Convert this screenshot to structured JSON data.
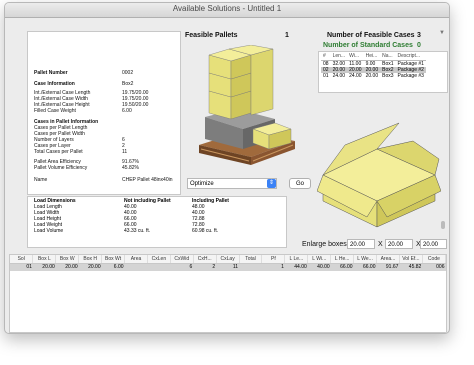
{
  "window": {
    "title": "Available Solutions - Untitled 1"
  },
  "info": {
    "rows": [
      {
        "label": "Pallet Number",
        "value": "0002",
        "bold": true
      },
      {
        "label": "Case Information",
        "value": "Box2",
        "bold": true
      },
      {
        "label": "Int./External Case Length",
        "value": "19.75/20.00",
        "bold": false
      },
      {
        "label": "Int./External Case Width",
        "value": "19.75/20.00",
        "bold": false
      },
      {
        "label": "Int./External Case Height",
        "value": "19.50/20.00",
        "bold": false
      },
      {
        "label": "Filled Case Weight",
        "value": "6.00",
        "bold": false
      },
      {
        "label": "Cases in Pallet Information",
        "value": "",
        "bold": true
      },
      {
        "label": "Cases per Pallet Length",
        "value": "",
        "bold": false
      },
      {
        "label": "Cases per Pallet Width",
        "value": "",
        "bold": false
      },
      {
        "label": "Number of Layers",
        "value": "6",
        "bold": false
      },
      {
        "label": "Cases per Layer",
        "value": "2",
        "bold": false
      },
      {
        "label": "Total Cases per Pallet",
        "value": "11",
        "bold": false
      },
      {
        "label": "Pallet Area Efficiency",
        "value": "91.67%",
        "bold": false
      },
      {
        "label": "Pallet Volume Efficiency",
        "value": "45.82%",
        "bold": false
      },
      {
        "label": "Name",
        "value": "CHEP Pallet 48inx40in",
        "bold": false
      }
    ]
  },
  "load": {
    "headers": [
      "Load Dimensions",
      "Not including Pallet",
      "Including Pallet"
    ],
    "rows": [
      [
        "Load Length",
        "40.00",
        "48.00"
      ],
      [
        "Load Width",
        "40.00",
        "40.00"
      ],
      [
        "Load Height",
        "66.00",
        "72.88"
      ],
      [
        "Load Weight",
        "66.00",
        "72.80"
      ],
      [
        "Load Volume",
        "43.33 cu. ft.",
        "60.98 cu. ft."
      ]
    ]
  },
  "feasible": {
    "label": "Feasible Pallets",
    "count": "1",
    "optimize_value": "Optimize",
    "go_label": "Go"
  },
  "cases": {
    "feasible_label": "Number of Feasible Cases",
    "feasible_count": "3",
    "standard_label": "Number of Standard Cases",
    "standard_count": "0",
    "headers": [
      "#",
      "Len...",
      "Wi...",
      "Hei...",
      "Na...",
      "Descript..."
    ],
    "rows": [
      [
        "08",
        "32.00",
        "11.00",
        "9.00",
        "Box1",
        "Package #1"
      ],
      [
        "02",
        "20.00",
        "20.00",
        "20.00",
        "Box2",
        "Package #2"
      ],
      [
        "01",
        "24.00",
        "24.00",
        "20.00",
        "Box3",
        "Package #3"
      ]
    ]
  },
  "enlarge": {
    "label": "Enlarge boxes",
    "x1": "20.00",
    "x2": "20.00",
    "x3": "20.00",
    "sep": "X"
  },
  "grid": {
    "headers": [
      "Sol",
      "Box L",
      "Box W",
      "Box H",
      "Box Wt",
      "Area",
      "CxLen",
      "CxWid",
      "CxH...",
      "CxLay",
      "Total",
      "Pf",
      "L Le...",
      "L Wi...",
      "L He...",
      "L We...",
      "Area...",
      "Vol Ef...",
      "Code"
    ],
    "rows": [
      [
        "01",
        "20.00",
        "20.00",
        "20.00",
        "6.00",
        "",
        "",
        "6",
        "2",
        "11",
        "",
        "1",
        "44.00",
        "40.00",
        "66.00",
        "66.00",
        "91.67",
        "45.82",
        "006"
      ]
    ]
  },
  "colors": {
    "box_face": "#e6e07a",
    "box_top": "#f3ee9a",
    "box_side": "#cfc75a",
    "pallet": "#a06a3c",
    "pallet_dark": "#6e4424",
    "standard_green": "#2e7d32"
  }
}
